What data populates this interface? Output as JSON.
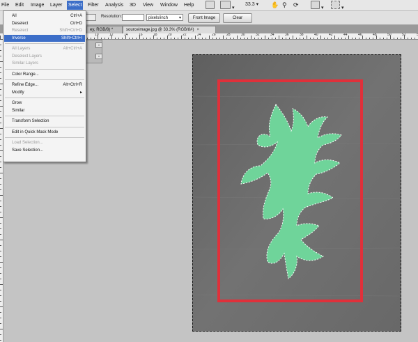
{
  "menubar": {
    "items": [
      "File",
      "Edit",
      "Image",
      "Layer",
      "Select",
      "Filter",
      "Analysis",
      "3D",
      "View",
      "Window",
      "Help"
    ],
    "zoom": "33.3",
    "icons": [
      "launch-bridge-icon",
      "view-extras-icon",
      "zoom-level-dropdown",
      "hand-tool-icon",
      "zoom-tool-icon",
      "rotate-view-icon",
      "arrange-documents-icon",
      "screen-mode-icon"
    ]
  },
  "options": {
    "resolution_label": "Resolution:",
    "resolution_value": "",
    "units": "pixels/inch",
    "front_image": "Front Image",
    "clear": "Clear"
  },
  "tabs": [
    {
      "label": "ey, RGB/8) *",
      "active": false
    },
    {
      "label": "sourceimage.jpg @ 33.3% (RGB/8#)",
      "active": true
    }
  ],
  "ruler": {
    "numbers": [
      "10",
      "12",
      "14",
      "16",
      "18",
      "20",
      "22",
      "24",
      "26",
      "28",
      "30",
      "32",
      "34",
      "36",
      "38",
      "40",
      "42",
      "44",
      "46",
      "48",
      "50",
      "52",
      "54",
      "56",
      "58",
      "60"
    ]
  },
  "minipanel": {
    "btn1": "«",
    "btn2": "«"
  },
  "select_menu": {
    "items": [
      {
        "label": "All",
        "shortcut": "Ctrl+A",
        "disabled": false
      },
      {
        "label": "Deselect",
        "shortcut": "Ctrl+D",
        "disabled": false
      },
      {
        "label": "Reselect",
        "shortcut": "Shift+Ctrl+D",
        "disabled": true
      },
      {
        "label": "Inverse",
        "shortcut": "Shift+Ctrl+I",
        "disabled": false,
        "highlighted": true
      },
      {
        "sep": true
      },
      {
        "label": "All Layers",
        "shortcut": "Alt+Ctrl+A",
        "disabled": true
      },
      {
        "label": "Deselect Layers",
        "shortcut": "",
        "disabled": true
      },
      {
        "label": "Similar Layers",
        "shortcut": "",
        "disabled": true
      },
      {
        "sep": true
      },
      {
        "label": "Color Range...",
        "shortcut": "",
        "disabled": false
      },
      {
        "sep": true
      },
      {
        "label": "Refine Edge...",
        "shortcut": "Alt+Ctrl+R",
        "disabled": false
      },
      {
        "label": "Modify",
        "shortcut": "",
        "disabled": false,
        "submenu": true
      },
      {
        "sep": true
      },
      {
        "label": "Grow",
        "shortcut": "",
        "disabled": false
      },
      {
        "label": "Similar",
        "shortcut": "",
        "disabled": false
      },
      {
        "sep": true
      },
      {
        "label": "Transform Selection",
        "shortcut": "",
        "disabled": false
      },
      {
        "sep": true
      },
      {
        "label": "Edit in Quick Mask Mode",
        "shortcut": "",
        "disabled": false
      },
      {
        "sep": true
      },
      {
        "label": "Load Selection...",
        "shortcut": "",
        "disabled": true
      },
      {
        "label": "Save Selection...",
        "shortcut": "",
        "disabled": false
      }
    ],
    "submenu_arrow": "▸"
  },
  "colors": {
    "highlight": "#3c6ec8",
    "frame": "#e0303a",
    "leaf": "#6fd49a"
  }
}
